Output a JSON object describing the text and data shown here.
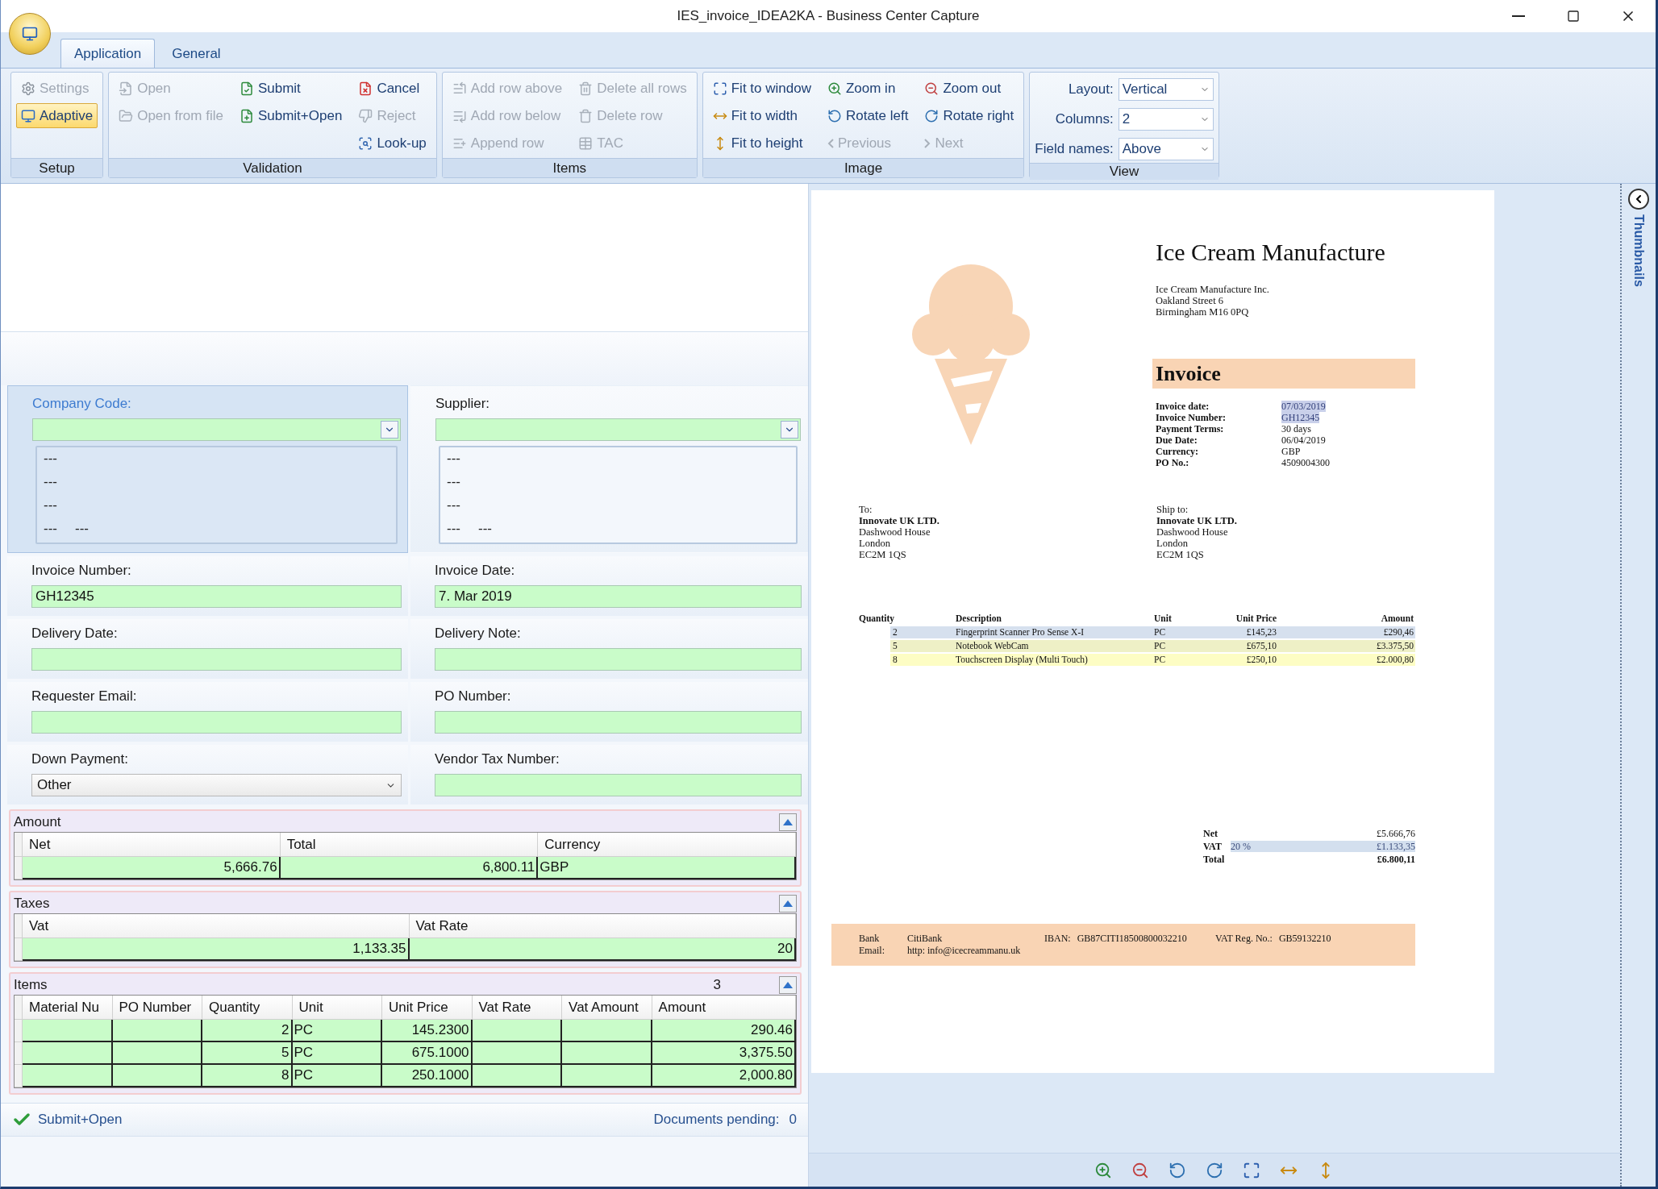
{
  "window": {
    "title": "IES_invoice_IDEA2KA - Business Center Capture"
  },
  "tabs": [
    {
      "label": "Application",
      "selected": true
    },
    {
      "label": "General",
      "selected": false
    }
  ],
  "ribbon": [
    {
      "title": "Setup",
      "kind": "buttons",
      "columns": [
        [
          {
            "label": "Settings",
            "disabled": true,
            "on": false
          },
          {
            "label": "Adaptive",
            "disabled": false,
            "on": true
          }
        ]
      ]
    },
    {
      "title": "Validation",
      "kind": "buttons",
      "columns": [
        [
          {
            "label": "Open",
            "disabled": true
          },
          {
            "label": "Open from file",
            "disabled": true
          }
        ],
        [
          {
            "label": "Submit",
            "disabled": false
          },
          {
            "label": "Submit+Open",
            "disabled": false
          }
        ],
        [
          {
            "label": "Cancel",
            "disabled": false
          },
          {
            "label": "Reject",
            "disabled": true
          },
          {
            "label": "Look-up",
            "disabled": false
          }
        ]
      ]
    },
    {
      "title": "Items",
      "kind": "buttons",
      "columns": [
        [
          {
            "label": "Add row above",
            "disabled": true
          },
          {
            "label": "Add row below",
            "disabled": true
          },
          {
            "label": "Append row",
            "disabled": true
          }
        ],
        [
          {
            "label": "Delete all rows",
            "disabled": true
          },
          {
            "label": "Delete row",
            "disabled": true
          },
          {
            "label": "TAC",
            "disabled": true
          }
        ]
      ]
    },
    {
      "title": "Image",
      "kind": "buttons",
      "columns": [
        [
          {
            "label": "Fit to window",
            "disabled": false
          },
          {
            "label": "Fit to width",
            "disabled": false
          },
          {
            "label": "Fit to height",
            "disabled": false
          }
        ],
        [
          {
            "label": "Zoom in",
            "disabled": false
          },
          {
            "label": "Rotate left",
            "disabled": false
          },
          {
            "label": "Previous",
            "disabled": true
          }
        ],
        [
          {
            "label": "Zoom out",
            "disabled": false
          },
          {
            "label": "Rotate right",
            "disabled": false
          },
          {
            "label": "Next",
            "disabled": true
          }
        ]
      ]
    },
    {
      "title": "View",
      "kind": "fields",
      "fields": [
        {
          "label": "Layout:",
          "value": "Vertical"
        },
        {
          "label": "Columns:",
          "value": "2"
        },
        {
          "label": "Field names:",
          "value": "Above"
        }
      ]
    }
  ],
  "lookups": [
    {
      "label": "Company Code:",
      "focused": true,
      "lines": [
        [
          "---"
        ],
        [
          "---"
        ],
        [
          "---"
        ],
        [
          "---",
          "---"
        ]
      ]
    },
    {
      "label": "Supplier:",
      "focused": false,
      "lines": [
        [
          "---"
        ],
        [
          "---"
        ],
        [
          "---"
        ],
        [
          "---",
          "---"
        ]
      ]
    }
  ],
  "fields": [
    {
      "label": "Invoice Number:",
      "kind": "text",
      "value": "GH12345"
    },
    {
      "label": "Invoice Date:",
      "kind": "text",
      "value": "7. Mar 2019"
    },
    {
      "label": "Delivery Date:",
      "kind": "text"
    },
    {
      "label": "Delivery Note:",
      "kind": "text"
    },
    {
      "label": "Requester Email:",
      "kind": "text"
    },
    {
      "label": "PO Number:",
      "kind": "text"
    },
    {
      "label": "Down Payment:",
      "kind": "select",
      "value": "Other"
    },
    {
      "label": "Vendor Tax Number:",
      "kind": "text"
    }
  ],
  "sections": [
    {
      "title": "Amount",
      "columns": [
        {
          "label": "Net",
          "kind": "number"
        },
        {
          "label": "Total",
          "kind": "number"
        },
        {
          "label": "Currency",
          "kind": "text"
        }
      ],
      "rows": [
        [
          "5,666.76",
          "6,800.11",
          "GBP"
        ]
      ]
    },
    {
      "title": "Taxes",
      "columns": [
        {
          "label": "Vat",
          "kind": "number"
        },
        {
          "label": "Vat Rate",
          "kind": "number"
        }
      ],
      "rows": [
        [
          "1,133.35",
          "20"
        ]
      ]
    },
    {
      "title": "Items",
      "count": "3",
      "columns": [
        {
          "label": "Material Nu",
          "kind": "text"
        },
        {
          "label": "PO Number",
          "kind": "text"
        },
        {
          "label": "Quantity",
          "kind": "number"
        },
        {
          "label": "Unit",
          "kind": "text"
        },
        {
          "label": "Unit Price",
          "kind": "number"
        },
        {
          "label": "Vat Rate",
          "kind": "number"
        },
        {
          "label": "Vat Amount",
          "kind": "number"
        },
        {
          "label": "Amount",
          "kind": "number"
        }
      ],
      "rows": [
        [
          null,
          null,
          "2",
          "PC",
          "145.2300",
          null,
          null,
          "290.46"
        ],
        [
          null,
          null,
          "5",
          "PC",
          "675.1000",
          null,
          null,
          "3,375.50"
        ],
        [
          null,
          null,
          "8",
          "PC",
          "250.1000",
          null,
          null,
          "2,000.80"
        ]
      ]
    }
  ],
  "status_bar": {
    "action": "Submit+Open",
    "pending_label": "Documents pending:",
    "pending_count": "0"
  },
  "document": {
    "company": "Ice Cream Manufacture",
    "address": [
      "Ice Cream Manufacture Inc.",
      "Oakland Street 6",
      "Birmingham M16 0PQ"
    ],
    "heading": "Invoice",
    "details": [
      {
        "label": "Invoice date:",
        "value": "07/03/2019",
        "highlighted": true
      },
      {
        "label": "Invoice Number:",
        "value": "GH12345",
        "highlighted": true
      },
      {
        "label": "Payment Terms:",
        "value": "30 days",
        "highlighted": false
      },
      {
        "label": "Due Date:",
        "value": "06/04/2019",
        "highlighted": false
      },
      {
        "label": "Currency:",
        "value": "GBP",
        "highlighted": false
      },
      {
        "label": "PO No.:",
        "value": "4509004300",
        "highlighted": false
      }
    ],
    "addresses": [
      {
        "label": "To:",
        "name": "Innovate UK LTD.",
        "lines": [
          "Dashwood House",
          "London",
          "EC2M 1QS"
        ]
      },
      {
        "label": "Ship to:",
        "name": "Innovate UK LTD.",
        "lines": [
          "Dashwood House",
          "London",
          "EC2M 1QS"
        ]
      }
    ],
    "table": {
      "columns": [
        "Quantity",
        "Description",
        "Unit",
        "Unit Price",
        "Amount"
      ],
      "rows": [
        {
          "cells": [
            "2",
            "Fingerprint Scanner Pro Sense X-I",
            "PC",
            "£145,23",
            "£290,46"
          ],
          "color": "#d6e0ee"
        },
        {
          "cells": [
            "5",
            "Notebook WebCam",
            "PC",
            "£675,10",
            "£3.375,50"
          ],
          "color": "#eef0c6"
        },
        {
          "cells": [
            "8",
            "Touchscreen Display (Multi Touch)",
            "PC",
            "£250,10",
            "£2.000,80"
          ],
          "color": "#fdfdc4"
        }
      ]
    },
    "totals": [
      {
        "label": "Net",
        "value": "£5.666,76",
        "highlighted": false
      },
      {
        "label": "VAT",
        "rate": "20 %",
        "value": "£1.133,35",
        "highlighted": true
      },
      {
        "label": "Total",
        "value": "£6.800,11",
        "highlighted": false
      }
    ],
    "footer": [
      [
        {
          "label": "Bank",
          "value": "CitiBank"
        },
        {
          "label": "IBAN:",
          "value": "GB87CITI18500800032210"
        },
        {
          "label": "VAT Reg. No.:",
          "value": "GB59132210"
        }
      ],
      [
        {
          "label": "Email:",
          "value": "http: info@icecreammanu.uk"
        }
      ]
    ]
  },
  "thumbnails": {
    "label": "Thumbnails"
  }
}
